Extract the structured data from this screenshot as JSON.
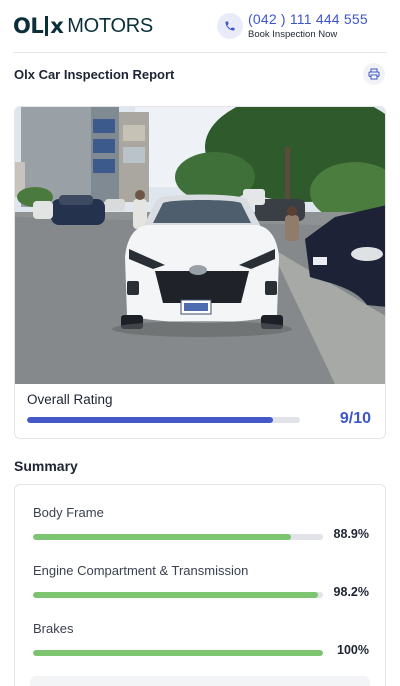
{
  "header": {
    "logo_olx": "OL",
    "logo_x": "x",
    "logo_motors": "MOTORS",
    "phone_number": "(042 ) 111 444 555",
    "phone_subtitle": "Book Inspection Now",
    "phone_icon": "phone-icon"
  },
  "report": {
    "title": "Olx Car Inspection Report",
    "print_icon": "printer-icon"
  },
  "overall": {
    "label": "Overall Rating",
    "value_text": "9/10",
    "fraction": 0.9,
    "color": "#4458c8"
  },
  "summary": {
    "title": "Summary",
    "bar_color": "#7cc46f",
    "items": [
      {
        "label": "Body Frame",
        "value_text": "88.9%",
        "percent": 88.9
      },
      {
        "label": "Engine Compartment & Transmission",
        "value_text": "98.2%",
        "percent": 98.2
      },
      {
        "label": "Brakes",
        "value_text": "100%",
        "percent": 100
      }
    ]
  },
  "colors": {
    "accent": "#3d56c9",
    "brand_dark": "#0b2f3a"
  }
}
